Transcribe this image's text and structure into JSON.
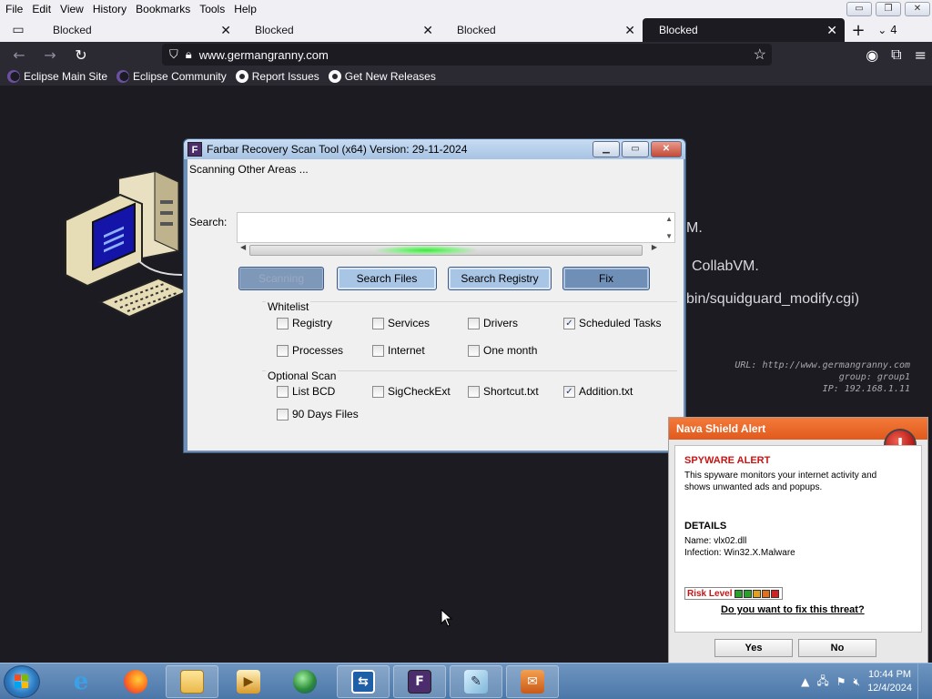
{
  "browser": {
    "menu": [
      "File",
      "Edit",
      "View",
      "History",
      "Bookmarks",
      "Tools",
      "Help"
    ],
    "window_controls": {
      "minimize": "▭",
      "restore": "❐",
      "close": "✕"
    },
    "tabs": [
      {
        "title": "Blocked",
        "active": false
      },
      {
        "title": "Blocked",
        "active": false
      },
      {
        "title": "Blocked",
        "active": false
      },
      {
        "title": "Blocked",
        "active": true
      }
    ],
    "tab_count": "4",
    "url": "www.germangranny.com",
    "bookmarks": [
      {
        "label": "Eclipse Main Site",
        "icon": "eclipse-icon"
      },
      {
        "label": "Eclipse Community",
        "icon": "eclipse-icon"
      },
      {
        "label": "Report Issues",
        "icon": "github-icon"
      },
      {
        "label": "Get New Releases",
        "icon": "github-icon"
      }
    ]
  },
  "page": {
    "fragments": [
      "M.",
      "CollabVM.",
      "bin/squidguard_modify.cgi)"
    ],
    "url_info": "URL: http://www.germangranny.com",
    "group_info": "group: group1",
    "ip_info": "IP: 192.168.1.11"
  },
  "frst": {
    "title": "Farbar Recovery Scan Tool (x64) Version: 29-11-2024",
    "status": "Scanning Other Areas ...",
    "search_label": "Search:",
    "progress_fraction": 0.45,
    "buttons": {
      "scanning": "Scanning",
      "search_files": "Search Files",
      "search_registry": "Search Registry",
      "fix": "Fix"
    },
    "whitelist_label": "Whitelist",
    "whitelist": [
      {
        "label": "Registry",
        "checked": false
      },
      {
        "label": "Services",
        "checked": false
      },
      {
        "label": "Drivers",
        "checked": false
      },
      {
        "label": "Scheduled Tasks",
        "checked": true
      },
      {
        "label": "Processes",
        "checked": false
      },
      {
        "label": "Internet",
        "checked": false
      },
      {
        "label": "One month",
        "checked": false
      }
    ],
    "optional_label": "Optional Scan",
    "optional": [
      {
        "label": "List BCD",
        "checked": false
      },
      {
        "label": "SigCheckExt",
        "checked": false
      },
      {
        "label": "Shortcut.txt",
        "checked": false
      },
      {
        "label": "Addition.txt",
        "checked": true
      },
      {
        "label": "90 Days Files",
        "checked": false
      }
    ]
  },
  "nava": {
    "title": "Nava Shield Alert",
    "alert_heading": "SPYWARE ALERT",
    "alert_desc": "This spyware monitors your internet activity and shows unwanted ads and popups.",
    "details_heading": "DETAILS",
    "name_line": "Name: vlx02.dll",
    "infection_line": "Infection: Win32.X.Malware",
    "risk_label": "Risk Level",
    "risk_colors": [
      "#2aa02a",
      "#2aa02a",
      "#e0a020",
      "#e07020",
      "#d02020"
    ],
    "question": "Do you want to fix this threat?",
    "yes": "Yes",
    "no": "No"
  },
  "taskbar": {
    "time": "10:44 PM",
    "date": "12/4/2024"
  },
  "colors": {
    "page_bg": "#1c1b22",
    "frst_frame": "#6f8fb7",
    "nava_title": "#e8601f",
    "taskbar": "#5a84b4"
  }
}
